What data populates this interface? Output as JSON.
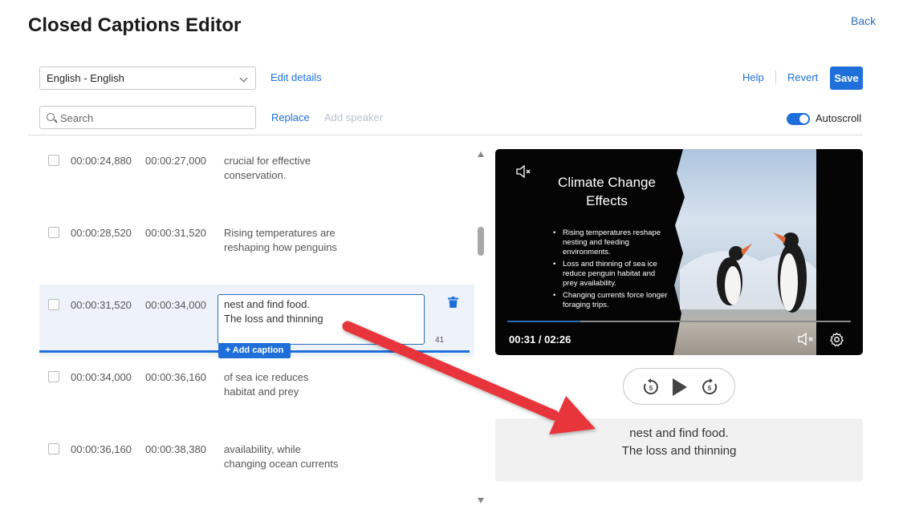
{
  "header": {
    "title": "Closed Captions Editor",
    "back_label": "Back"
  },
  "toolbar": {
    "language_selected": "English - English",
    "edit_details_label": "Edit details",
    "help_label": "Help",
    "revert_label": "Revert",
    "save_label": "Save",
    "search_placeholder": "Search",
    "replace_label": "Replace",
    "add_speaker_label": "Add speaker",
    "autoscroll_label": "Autoscroll",
    "autoscroll_on": true
  },
  "captions": [
    {
      "start": "00:00:24,880",
      "end": "00:00:27,000",
      "line1": "crucial for effective",
      "line2": "conservation."
    },
    {
      "start": "00:00:28,520",
      "end": "00:00:31,520",
      "line1": "Rising temperatures are",
      "line2": "reshaping how penguins"
    },
    {
      "start": "00:00:31,520",
      "end": "00:00:34,000",
      "line1": "nest and find food.",
      "line2": "The loss and thinning",
      "char_count": "41"
    },
    {
      "start": "00:00:34,000",
      "end": "00:00:36,160",
      "line1": "of sea ice reduces",
      "line2": "habitat and prey"
    },
    {
      "start": "00:00:36,160",
      "end": "00:00:38,380",
      "line1": "availability, while",
      "line2": "changing ocean currents"
    }
  ],
  "add_caption_label": "+ Add caption",
  "video": {
    "slide_title_line1": "Climate Change",
    "slide_title_line2": "Effects",
    "bullets": [
      "Rising temperatures reshape nesting and feeding environments.",
      "Loss and thinning of sea ice reduce penguin habitat and prey availability.",
      "Changing currents force longer foraging trips."
    ],
    "time": "00:31 / 02:26",
    "progress_fraction": 0.212
  },
  "preview": {
    "line1": "nest and find food.",
    "line2": "The loss and thinning"
  },
  "colors": {
    "accent": "#1e6fd9",
    "arrow": "#e8353b"
  },
  "icons": {
    "rewind": "rewind-5-icon",
    "play": "play-icon",
    "forward": "forward-5-icon",
    "mute": "mute-icon",
    "settings": "gear-icon",
    "delete": "trash-icon",
    "search": "search-icon"
  }
}
